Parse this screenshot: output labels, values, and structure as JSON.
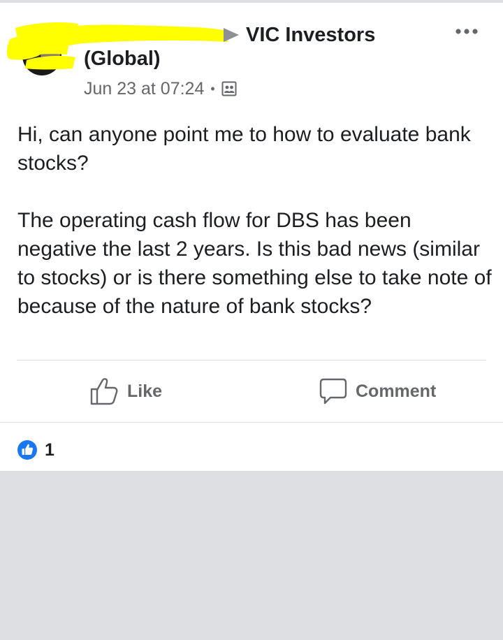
{
  "post": {
    "header": {
      "author_name_redacted": true,
      "group_name_line1": "VIC Investors",
      "group_name_line2": "(Global)",
      "timestamp": "Jun 23 at 07:24",
      "separator": "•",
      "audience_icon": "group-audience-icon",
      "more_icon": "more-options-icon"
    },
    "body": {
      "paragraphs": [
        "Hi, can anyone point me to how to evaluate bank stocks?",
        "The operating cash flow for DBS has been negative the last 2 years. Is this bad news (similar to stocks) or is there something else to take note of because of the nature of bank stocks?"
      ]
    },
    "actions": {
      "like_label": "Like",
      "like_icon": "thumbs-up-outline-icon",
      "comment_label": "Comment",
      "comment_icon": "speech-bubble-icon"
    },
    "reactions": {
      "icon": "like-reaction-icon",
      "count": "1"
    }
  },
  "colors": {
    "text_primary": "#1c1e21",
    "text_secondary": "#65676b",
    "like_blue": "#1877f2",
    "redaction_yellow": "#ffff00",
    "background_gray": "#dddfe3"
  }
}
